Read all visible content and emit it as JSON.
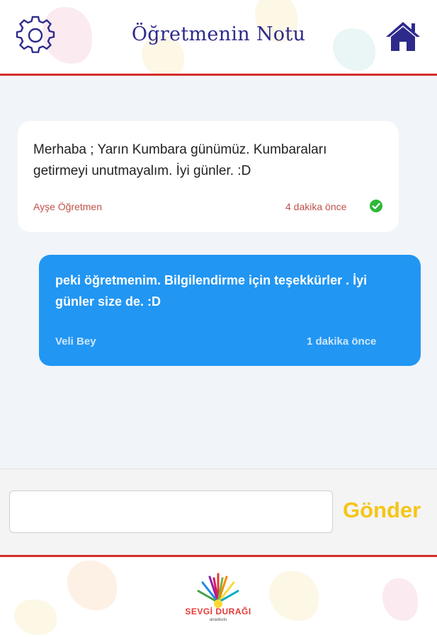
{
  "header": {
    "title": "Öğretmenin Notu",
    "settings_icon": "gear-icon",
    "home_icon": "home-icon"
  },
  "messages": [
    {
      "text": "Merhaba ; Yarın Kumbara günümüz. Kumbaraları getirmeyi unutmayalım. İyi günler. :D",
      "author": "Ayşe Öğretmen",
      "time": "4 dakika önce",
      "status_icon": "check-circle-icon"
    },
    {
      "text": "peki öğretmenim. Bilgilendirme için teşekkürler . İyi günler size de. :D",
      "author": "Veli Bey",
      "time": "1 dakika önce"
    }
  ],
  "composer": {
    "input_value": "",
    "send_label": "Gönder"
  },
  "footer": {
    "logo_text": "SEVGİ DURAĞI",
    "logo_sub": "anaokulu"
  },
  "colors": {
    "title": "#2d2a8c",
    "accent_line": "#d62b2b",
    "outgoing_bubble": "#2196f3",
    "send_button": "#f5c518",
    "incoming_meta": "#c0524a"
  }
}
